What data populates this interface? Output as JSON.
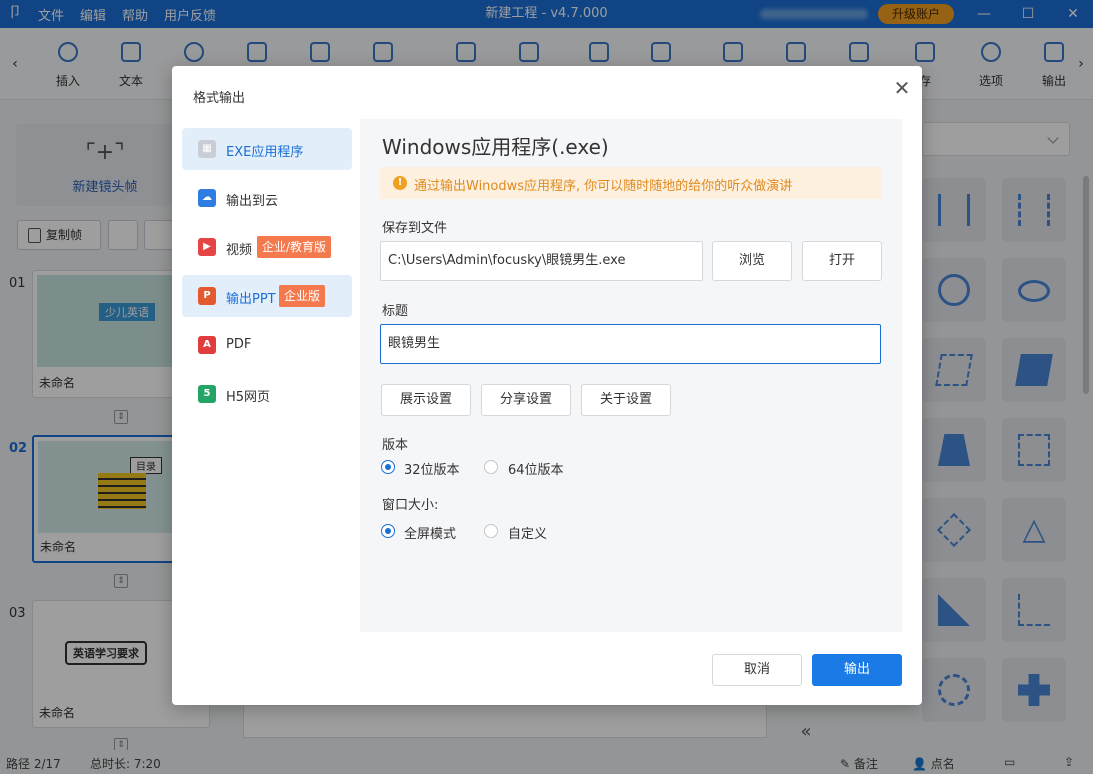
{
  "window": {
    "title": "新建工程 - v4.7.000",
    "menu": [
      "文件",
      "编辑",
      "帮助",
      "用户反馈"
    ],
    "upgrade": "升级账户"
  },
  "toolbar": {
    "items": [
      {
        "label": "插入",
        "icon": "plus-circle-icon"
      },
      {
        "label": "文本",
        "icon": "text-icon"
      },
      {
        "label": "存",
        "icon": "save-icon"
      },
      {
        "label": "选项",
        "icon": "gear-icon"
      },
      {
        "label": "输出",
        "icon": "export-icon"
      }
    ]
  },
  "left_panel": {
    "new_frame": "新建镜头帧",
    "copy_frame": "复制帧",
    "slides": [
      {
        "num": "01",
        "name": "未命名",
        "thumb_text": "少儿英语"
      },
      {
        "num": "02",
        "name": "未命名",
        "thumb_text": "目录"
      },
      {
        "num": "03",
        "name": "未命名",
        "thumb_text": "英语学习要求"
      }
    ]
  },
  "status": {
    "path": "路径 2/17",
    "duration": "总时长: 7:20",
    "notes": "备注",
    "roll_call": "点名"
  },
  "dialog": {
    "title": "格式输出",
    "nav": [
      {
        "label": "EXE应用程序",
        "icon": "windows-icon",
        "color": "#c9ced6",
        "active": true,
        "tag": ""
      },
      {
        "label": "输出到云",
        "icon": "cloud-icon",
        "color": "#2f7de1",
        "active": false,
        "tag": ""
      },
      {
        "label": "视频",
        "icon": "play-icon",
        "color": "#e64545",
        "active": false,
        "tag": "企业/教育版"
      },
      {
        "label": "输出PPT",
        "icon": "ppt-icon",
        "color": "#e35a2e",
        "active": false,
        "tag": "企业版"
      },
      {
        "label": "PDF",
        "icon": "pdf-icon",
        "color": "#e23d3d",
        "active": false,
        "tag": ""
      },
      {
        "label": "H5网页",
        "icon": "html5-icon",
        "color": "#22a565",
        "active": false,
        "tag": ""
      }
    ],
    "heading": "Windows应用程序(.exe)",
    "notice": "通过输出Winodws应用程序, 你可以随时随地的给你的听众做演讲",
    "save_label": "保存到文件",
    "save_path": "C:\\Users\\Admin\\focusky\\眼镜男生.exe",
    "browse": "浏览",
    "open": "打开",
    "title_label": "标题",
    "title_value": "眼镜男生",
    "settings": [
      "展示设置",
      "分享设置",
      "关于设置"
    ],
    "version_label": "版本",
    "version_options": [
      "32位版本",
      "64位版本"
    ],
    "window_label": "窗口大小:",
    "window_options": [
      "全屏模式",
      "自定义"
    ],
    "cancel": "取消",
    "confirm": "输出"
  }
}
